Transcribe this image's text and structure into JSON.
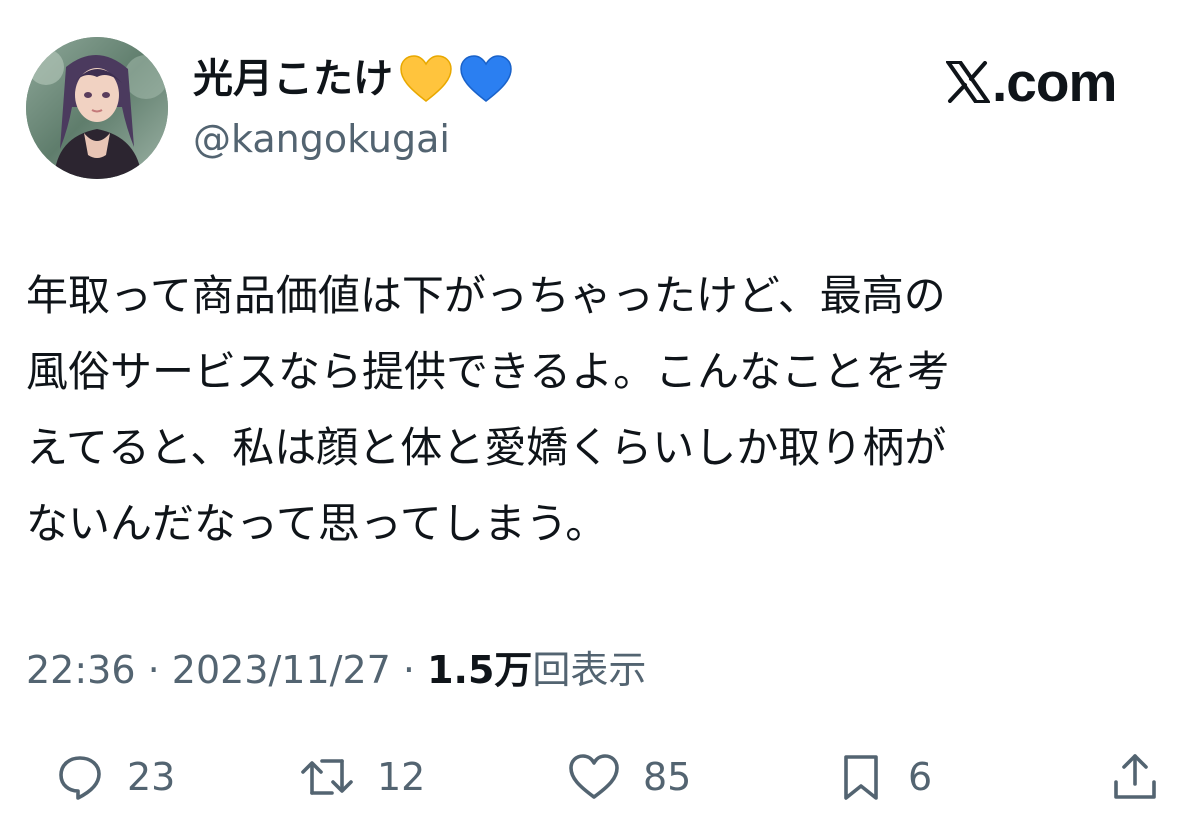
{
  "author": {
    "display_name": "光月こたけ",
    "handle": "@kangokugai",
    "avatar": "avatar-portrait",
    "badges": [
      {
        "icon": "yellow-heart-icon",
        "color": "#ffc43d"
      },
      {
        "icon": "blue-heart-icon",
        "color": "#2b7ff1"
      }
    ]
  },
  "brand": {
    "logo": "x-logo",
    "suffix": ".com"
  },
  "tweet": {
    "lines": [
      "年取って商品価値は下がっちゃったけど、最高の",
      "風俗サービスなら提供できるよ。こんなことを考",
      "えてると、私は顔と体と愛嬌くらいしか取り柄が",
      "ないんだなって思ってしまう。"
    ]
  },
  "meta": {
    "time": "22:36",
    "separator": "·",
    "date": "2023/11/27",
    "views_count": "1.5万",
    "views_label": "回表示"
  },
  "actions": {
    "reply": {
      "icon": "reply-icon",
      "count": "23"
    },
    "retweet": {
      "icon": "retweet-icon",
      "count": "12"
    },
    "like": {
      "icon": "like-icon",
      "count": "85"
    },
    "bookmark": {
      "icon": "bookmark-icon",
      "count": "6"
    },
    "share": {
      "icon": "share-icon"
    }
  },
  "colors": {
    "text_primary": "#0f1419",
    "text_secondary": "#536471",
    "background": "#ffffff"
  }
}
